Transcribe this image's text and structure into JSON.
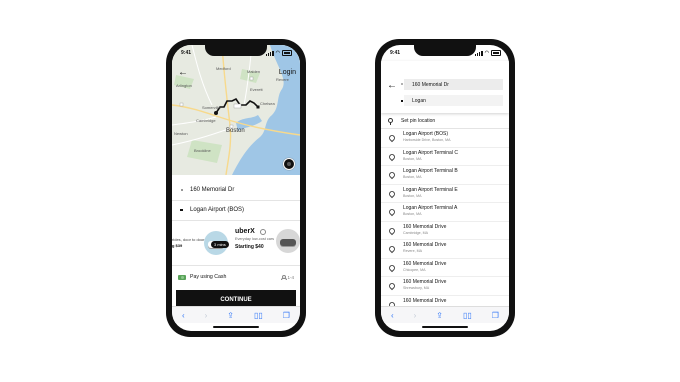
{
  "left_phone": {
    "status_time": "9:41",
    "login_label": "Login",
    "map_labels": [
      "Arlington",
      "Medford",
      "Malden",
      "Everett",
      "Revere",
      "Somerville",
      "Chelsea",
      "Cambridge",
      "Boston",
      "Brookline",
      "Newton"
    ],
    "pickup": "160 Memorial Dr",
    "dropoff": "Logan Airport (BOS)",
    "car_left": {
      "line1": "rides, door to door",
      "line2": "g $39"
    },
    "eta": "3 mins",
    "uberx": {
      "title": "uberX",
      "desc": "Everyday low-cost cars",
      "price": "Starting $40"
    },
    "payment": "Pay using Cash",
    "seats": "1-4",
    "continue_label": "CONTINUE"
  },
  "right_phone": {
    "status_time": "9:41",
    "from_value": "160 Memorial Dr",
    "to_value": "Logan",
    "set_pin_label": "Set pin location",
    "results": [
      {
        "name": "Logan Airport (BOS)",
        "sub": "Harborside Drive, Boston, MA"
      },
      {
        "name": "Logan Airport Terminal C",
        "sub": "Boston, MA"
      },
      {
        "name": "Logan Airport Terminal B",
        "sub": "Boston, MA"
      },
      {
        "name": "Logan Airport Terminal E",
        "sub": "Boston, MA"
      },
      {
        "name": "Logan Airport Terminal A",
        "sub": "Boston, MA"
      },
      {
        "name": "160 Memorial Drive",
        "sub": "Cambridge, MA"
      },
      {
        "name": "160 Memorial Drive",
        "sub": "Revere, MA"
      },
      {
        "name": "160 Memorial Drive",
        "sub": "Chicopee, MA"
      },
      {
        "name": "160 Memorial Drive",
        "sub": "Shrewsbury, MA"
      },
      {
        "name": "160 Memorial Drive",
        "sub": ""
      }
    ]
  },
  "colors": {
    "accent": "#111111",
    "safari_blue": "#3478f6",
    "water": "#9fc6e6",
    "cash_green": "#5aa35a"
  }
}
